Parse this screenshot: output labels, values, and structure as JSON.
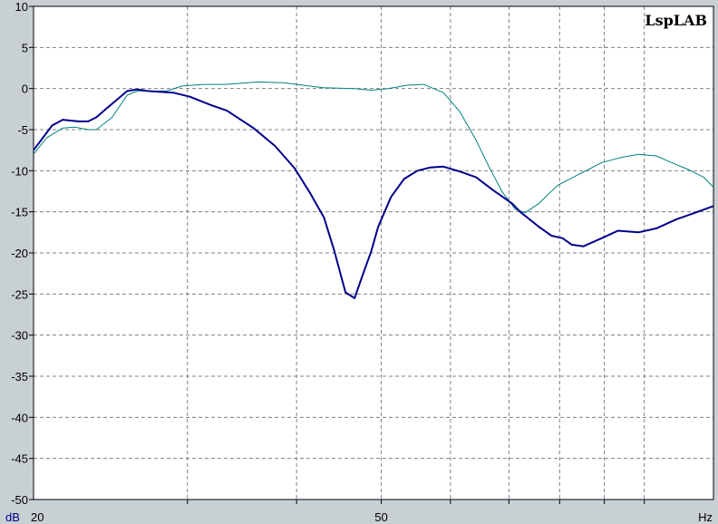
{
  "chart_data": {
    "type": "line",
    "brand": "LspLAB",
    "x_unit_label": "Hz",
    "y_unit_label": "dB",
    "x_scale": "log",
    "xlim": [
      20,
      120
    ],
    "ylim": [
      -50,
      10
    ],
    "y_ticks": [
      10,
      5,
      0,
      -5,
      -10,
      -15,
      -20,
      -25,
      -30,
      -35,
      -40,
      -45,
      -50
    ],
    "x_tick_labels": [
      {
        "value": 20,
        "label": "20"
      },
      {
        "value": 50,
        "label": "50"
      }
    ],
    "x_gridlines": [
      30,
      40,
      60,
      70,
      80,
      90,
      100
    ],
    "grid": true,
    "colors": {
      "background": "#c8d0d4",
      "plot_background": "#ffffff",
      "grid": "#808080",
      "series_1": "#00008b",
      "series_2": "#008080",
      "y_unit": "#00008b"
    },
    "series": [
      {
        "color": "#00008b",
        "width": 2,
        "points": [
          [
            20,
            -7.5
          ],
          [
            21,
            -4.5
          ],
          [
            21.6,
            -3.8
          ],
          [
            22.5,
            -4.0
          ],
          [
            23.1,
            -4.0
          ],
          [
            23.6,
            -3.5
          ],
          [
            24.2,
            -2.5
          ],
          [
            25.6,
            -0.3
          ],
          [
            26.3,
            -0.1
          ],
          [
            27,
            -0.3
          ],
          [
            28.9,
            -0.5
          ],
          [
            30.2,
            -1.0
          ],
          [
            31.9,
            -2.0
          ],
          [
            33.3,
            -2.7
          ],
          [
            35.7,
            -4.8
          ],
          [
            37.8,
            -7.0
          ],
          [
            39.8,
            -9.7
          ],
          [
            41.5,
            -12.8
          ],
          [
            43,
            -15.7
          ],
          [
            44.2,
            -19.8
          ],
          [
            45.5,
            -24.8
          ],
          [
            46.6,
            -25.5
          ],
          [
            47.6,
            -22.7
          ],
          [
            48.7,
            -19.8
          ],
          [
            49.6,
            -16.8
          ],
          [
            51.3,
            -13.2
          ],
          [
            53.1,
            -11.0
          ],
          [
            55,
            -10.0
          ],
          [
            56.9,
            -9.6
          ],
          [
            58.9,
            -9.5
          ],
          [
            61.5,
            -10.1
          ],
          [
            64.2,
            -10.8
          ],
          [
            67,
            -12.3
          ],
          [
            70.6,
            -14.0
          ],
          [
            72.1,
            -15.0
          ],
          [
            75.7,
            -16.8
          ],
          [
            78.3,
            -17.9
          ],
          [
            80.6,
            -18.2
          ],
          [
            82.6,
            -19.0
          ],
          [
            85.2,
            -19.2
          ],
          [
            89.4,
            -18.2
          ],
          [
            93.3,
            -17.3
          ],
          [
            98.5,
            -17.5
          ],
          [
            103.3,
            -17.0
          ],
          [
            108.9,
            -15.9
          ],
          [
            114.4,
            -15.1
          ],
          [
            120,
            -14.3
          ]
        ]
      },
      {
        "color": "#008080",
        "width": 1,
        "points": [
          [
            20,
            -8.0
          ],
          [
            20.7,
            -6.0
          ],
          [
            21.6,
            -4.8
          ],
          [
            22.3,
            -4.7
          ],
          [
            23.1,
            -5.0
          ],
          [
            23.6,
            -5.0
          ],
          [
            24.6,
            -3.5
          ],
          [
            25.6,
            -0.8
          ],
          [
            26.3,
            -0.3
          ],
          [
            28.4,
            -0.3
          ],
          [
            29.6,
            0.3
          ],
          [
            31.3,
            0.5
          ],
          [
            33.2,
            0.5
          ],
          [
            36.1,
            0.8
          ],
          [
            38.6,
            0.7
          ],
          [
            42.9,
            0.1
          ],
          [
            46.6,
            0.0
          ],
          [
            48.7,
            -0.2
          ],
          [
            50.9,
            0.0
          ],
          [
            53.6,
            0.4
          ],
          [
            55.9,
            0.5
          ],
          [
            58.9,
            -0.5
          ],
          [
            61.5,
            -2.8
          ],
          [
            64.2,
            -6.3
          ],
          [
            66.4,
            -9.5
          ],
          [
            68.8,
            -12.6
          ],
          [
            71.2,
            -14.7
          ],
          [
            73.1,
            -15.1
          ],
          [
            75.7,
            -14.0
          ],
          [
            79.5,
            -11.8
          ],
          [
            83.9,
            -10.5
          ],
          [
            86.5,
            -9.8
          ],
          [
            89.4,
            -9.0
          ],
          [
            94,
            -8.4
          ],
          [
            98.5,
            -8.0
          ],
          [
            103.3,
            -8.2
          ],
          [
            107.4,
            -9.0
          ],
          [
            112,
            -9.8
          ],
          [
            117,
            -10.8
          ],
          [
            120,
            -12.0
          ]
        ]
      }
    ]
  }
}
